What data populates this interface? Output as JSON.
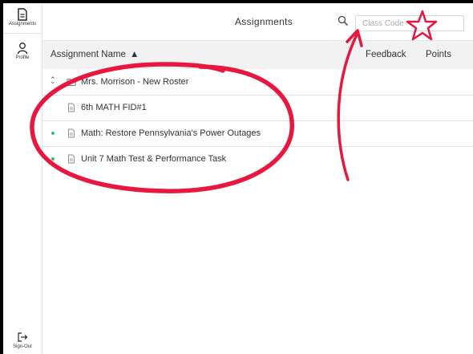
{
  "sidebar": {
    "assignments_label": "Assignments",
    "profile_label": "Profile",
    "signout_label": "Sign-Out"
  },
  "header": {
    "title": "Assignments",
    "class_code_placeholder": "Class Code"
  },
  "columns": {
    "name": "Assignment Name",
    "feedback": "Feedback",
    "points": "Points"
  },
  "rows": [
    {
      "label": "Mrs. Morrison - New Roster",
      "kind": "folder",
      "new": false
    },
    {
      "label": "6th MATH FID#1",
      "kind": "file",
      "new": false
    },
    {
      "label": "Math:  Restore Pennsylvania's Power Outages",
      "kind": "file",
      "new": true
    },
    {
      "label": "Unit 7 Math Test & Performance Task",
      "kind": "file",
      "new": true
    }
  ],
  "colors": {
    "annotation": "#e8173f",
    "new_dot": "#3cb878"
  }
}
